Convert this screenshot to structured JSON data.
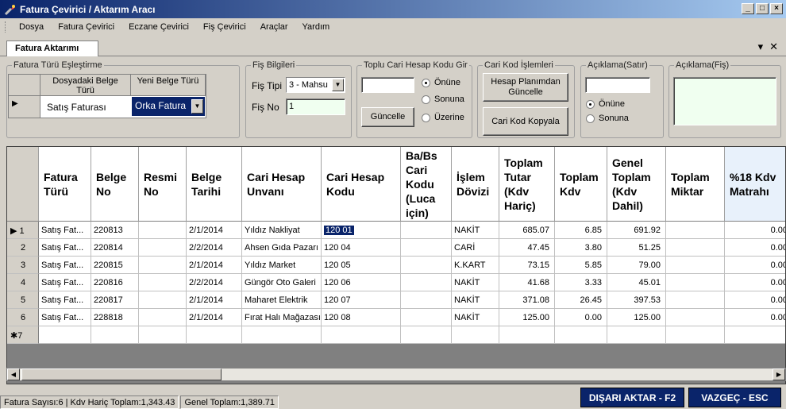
{
  "window": {
    "title": "Fatura Çevirici / Aktarım Aracı",
    "min": "_",
    "max": "□",
    "close": "×"
  },
  "menu": [
    "Dosya",
    "Fatura Çevirici",
    "Eczane Çevirici",
    "Fiş Çevirici",
    "Araçlar",
    "Yardım"
  ],
  "tab": {
    "label": "Fatura Aktarımı",
    "dropdown": "▾",
    "close": "✕"
  },
  "fatura_turu": {
    "legend": "Fatura Türü Eşleştirme",
    "col1": "Dosyadaki Belge Türü",
    "col2": "Yeni Belge Türü",
    "row_marker": "▶",
    "source_value": "Satış Faturası",
    "target_value": "Orka Fatura"
  },
  "fis_bilgileri": {
    "legend": "Fiş Bilgileri",
    "tipi_label": "Fiş Tipi",
    "tipi_value": "3 - Mahsu",
    "no_label": "Fiş No",
    "no_value": "1"
  },
  "toplu_cari": {
    "legend": "Toplu Cari Hesap Kodu Gir",
    "input_value": "",
    "radio_onune": "Önüne",
    "radio_sonuna": "Sonuna",
    "radio_uzerine": "Üzerine",
    "guncelle": "Güncelle"
  },
  "cari_kod": {
    "legend": "Cari Kod İşlemleri",
    "btn1": "Hesap Planımdan Güncelle",
    "btn2": "Cari Kod Kopyala"
  },
  "aciklama_satir": {
    "legend": "Açıklama(Satır)",
    "input_value": "",
    "radio_onune": "Önüne",
    "radio_sonuna": "Sonuna"
  },
  "aciklama_fis": {
    "legend": "Açıklama(Fiş)",
    "value": ""
  },
  "grid": {
    "columns": [
      "Fatura Türü",
      "Belge No",
      "Resmi No",
      "Belge Tarihi",
      "Cari Hesap Unvanı",
      "Cari Hesap Kodu",
      "Ba/Bs Cari Kodu (Luca için)",
      "İşlem Dövizi",
      "Toplam Tutar (Kdv Hariç)",
      "Toplam Kdv",
      "Genel Toplam (Kdv Dahil)",
      "Toplam Miktar",
      "%18 Kdv Matrahı"
    ],
    "rows": [
      {
        "hdr": "▶ 1",
        "fatura": "Satış Fat...",
        "belge": "220813",
        "resmi": "",
        "tarih": "2/1/2014",
        "unvan": "Yıldız Nakliyat",
        "kod": "120 01",
        "babs": "",
        "doviz": "NAKİT",
        "tutar": "685.07",
        "kdv": "6.85",
        "genel": "691.92",
        "miktar": "",
        "matrah": "0.00"
      },
      {
        "hdr": "2",
        "fatura": "Satış Fat...",
        "belge": "220814",
        "resmi": "",
        "tarih": "2/2/2014",
        "unvan": "Ahsen Gıda Pazarı",
        "kod": "120 04",
        "babs": "",
        "doviz": "CARİ",
        "tutar": "47.45",
        "kdv": "3.80",
        "genel": "51.25",
        "miktar": "",
        "matrah": "0.00"
      },
      {
        "hdr": "3",
        "fatura": "Satış Fat...",
        "belge": "220815",
        "resmi": "",
        "tarih": "2/1/2014",
        "unvan": "Yıldız Market",
        "kod": "120 05",
        "babs": "",
        "doviz": "K.KART",
        "tutar": "73.15",
        "kdv": "5.85",
        "genel": "79.00",
        "miktar": "",
        "matrah": "0.00"
      },
      {
        "hdr": "4",
        "fatura": "Satış Fat...",
        "belge": "220816",
        "resmi": "",
        "tarih": "2/2/2014",
        "unvan": "Güngör Oto Galeri",
        "kod": "120 06",
        "babs": "",
        "doviz": "NAKİT",
        "tutar": "41.68",
        "kdv": "3.33",
        "genel": "45.01",
        "miktar": "",
        "matrah": "0.00"
      },
      {
        "hdr": "5",
        "fatura": "Satış Fat...",
        "belge": "220817",
        "resmi": "",
        "tarih": "2/1/2014",
        "unvan": "Maharet Elektrik",
        "kod": "120 07",
        "babs": "",
        "doviz": "NAKİT",
        "tutar": "371.08",
        "kdv": "26.45",
        "genel": "397.53",
        "miktar": "",
        "matrah": "0.00"
      },
      {
        "hdr": "6",
        "fatura": "Satış Fat...",
        "belge": "228818",
        "resmi": "",
        "tarih": "2/1/2014",
        "unvan": "Fırat Halı Mağazası",
        "kod": "120 08",
        "babs": "",
        "doviz": "NAKİT",
        "tutar": "125.00",
        "kdv": "0.00",
        "genel": "125.00",
        "miktar": "",
        "matrah": "0.00"
      }
    ],
    "new_row_hdr": "✱7"
  },
  "status": {
    "left": "Fatura Sayısı:6 | Kdv Hariç Toplam:1,343.43",
    "right": "Genel Toplam:1,389.71"
  },
  "buttons": {
    "export": "DIŞARI AKTAR - F2",
    "cancel": "VAZGEÇ - ESC"
  }
}
